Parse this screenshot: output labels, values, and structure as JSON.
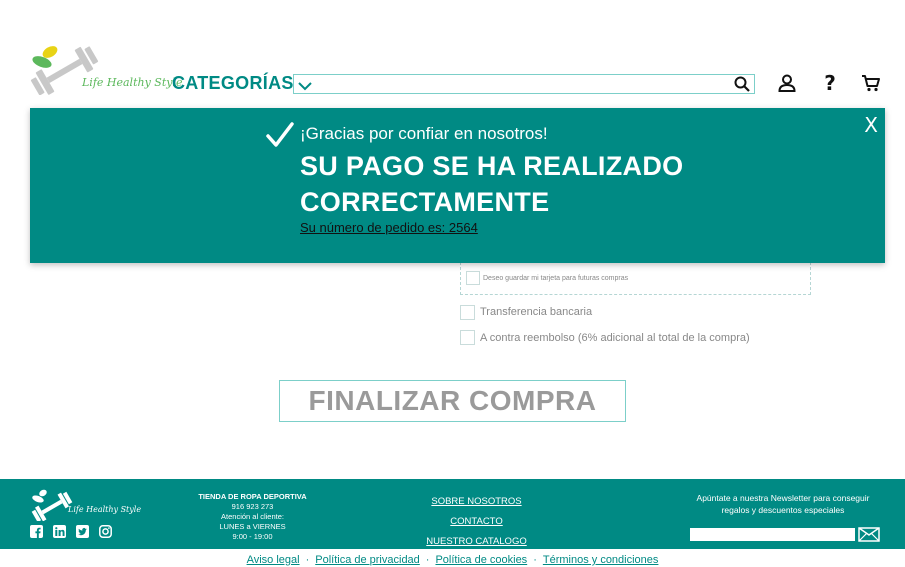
{
  "header": {
    "logo_text": "Life Healthy Style",
    "categories_label": "CATEGORÍAS",
    "search_placeholder": "",
    "help_label": "?"
  },
  "checkout": {
    "save_card_label": "Deseo guardar mi tarjeta para futuras compras",
    "transfer_label": "Transferencia bancaria",
    "cod_label": "A contra reembolso (6% adicional al total de la compra)",
    "finalize_label": "FINALIZAR COMPRA"
  },
  "modal": {
    "close_label": "X",
    "thanks": "¡Gracias por confiar en nosotros!",
    "headline": "SU PAGO SE HA REALIZADO CORRECTAMENTE",
    "order_text": "Su número de pedido es: 2564"
  },
  "footer": {
    "logo_text": "Life Healthy Style",
    "store_title": "TIENDA DE ROPA DEPORTIVA",
    "phone": "916 923 273",
    "attention": "Atención al cliente:",
    "days": "LUNES a VIERNES",
    "hours": "9:00 - 19:00",
    "links": [
      "SOBRE NOSOTROS",
      "CONTACTO",
      "NUESTRO CATALOGO"
    ],
    "newsletter_text": "Apúntate a nuestra Newsletter para conseguir regalos y descuentos especiales",
    "socials": [
      "facebook-icon",
      "linkedin-icon",
      "twitter-icon",
      "instagram-icon"
    ]
  },
  "legal": {
    "links": [
      "Aviso legal",
      "Política de privacidad",
      "Política de cookies",
      "Términos y condiciones"
    ],
    "separator": "·"
  },
  "colors": {
    "brand": "#008a84",
    "accent_green": "#5cb85c",
    "leaf_yellow": "#e8d316",
    "border": "#7ccfc9"
  }
}
